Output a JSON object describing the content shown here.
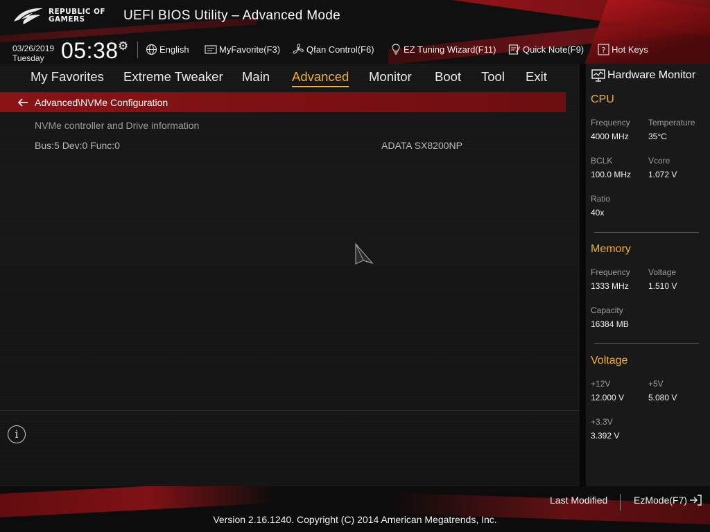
{
  "header": {
    "logo_lines": [
      "REPUBLIC OF",
      "GAMERS"
    ],
    "title": "UEFI BIOS Utility – Advanced Mode",
    "date": "03/26/2019",
    "weekday": "Tuesday",
    "time": "05:38",
    "clock_settings_icon": "gear-icon"
  },
  "toolbar": [
    {
      "label": "English",
      "icon": "globe-icon"
    },
    {
      "label": "MyFavorite(F3)",
      "icon": "favorites-icon"
    },
    {
      "label": "Qfan Control(F6)",
      "icon": "fan-icon"
    },
    {
      "label": "EZ Tuning Wizard(F11)",
      "icon": "lightbulb-icon"
    },
    {
      "label": "Quick Note(F9)",
      "icon": "note-icon"
    },
    {
      "label": "Hot Keys",
      "icon": "help-icon"
    }
  ],
  "nav": {
    "tabs": [
      "My Favorites",
      "Extreme Tweaker",
      "Main",
      "Advanced",
      "Monitor",
      "Boot",
      "Tool",
      "Exit"
    ],
    "active": "Advanced"
  },
  "breadcrumb": {
    "path": "Advanced\\NVMe Configuration",
    "back_icon": "arrow-left-icon"
  },
  "content": {
    "section_heading": "NVMe controller and Drive information",
    "rows": [
      {
        "label": "Bus:5 Dev:0 Func:0",
        "value": "ADATA SX8200NP"
      }
    ]
  },
  "info_icon": "info-icon",
  "hardware_monitor": {
    "title": "Hardware Monitor",
    "cpu": {
      "heading": "CPU",
      "frequency_label": "Frequency",
      "frequency": "4000 MHz",
      "temperature_label": "Temperature",
      "temperature": "35°C",
      "bclk_label": "BCLK",
      "bclk": "100.0 MHz",
      "vcore_label": "Vcore",
      "vcore": "1.072 V",
      "ratio_label": "Ratio",
      "ratio": "40x"
    },
    "memory": {
      "heading": "Memory",
      "frequency_label": "Frequency",
      "frequency": "1333 MHz",
      "voltage_label": "Voltage",
      "voltage": "1.510 V",
      "capacity_label": "Capacity",
      "capacity": "16384 MB"
    },
    "voltage": {
      "heading": "Voltage",
      "v12_label": "+12V",
      "v12": "12.000 V",
      "v5_label": "+5V",
      "v5": "5.080 V",
      "v33_label": "+3.3V",
      "v33": "3.392 V"
    }
  },
  "footer": {
    "last_modified": "Last Modified",
    "ezmode": "EzMode(F7)",
    "ezmode_icon": "exit-arrow-icon",
    "copyright": "Version 2.16.1240. Copyright (C) 2014 American Megatrends, Inc."
  },
  "colors": {
    "accent": "#f0b12a",
    "brand_red": "#a3141a",
    "breadcrumb_red": "#8a1316"
  }
}
